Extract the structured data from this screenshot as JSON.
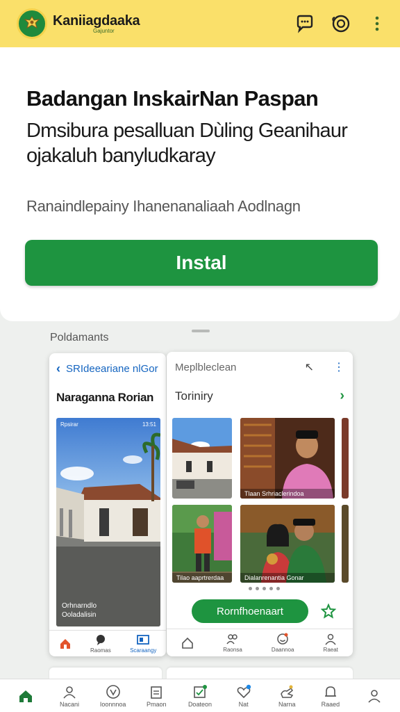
{
  "app": {
    "name": "Kaniiagdaaka",
    "tagline": "Gajuntor"
  },
  "header": {
    "actions": [
      "chat-icon",
      "smiley-icon",
      "more-vertical-icon"
    ]
  },
  "hero": {
    "title": "Badangan InskairNan Paspan",
    "description": "Dmsibura pesalluan Dùling Geanihaur ojakaluh banyludkaray",
    "note": "Ranaindlepainy Ihanenanaliaah Aodlnagn",
    "install_label": "Instal"
  },
  "screenshots": {
    "label": "Poldamants",
    "phone_a": {
      "back_label": "SRIdeeariane nlGor",
      "title": "Naraganna Rorian",
      "status_left": "Rpsirar",
      "status_right": "13:51",
      "photo_caption_1": "Orhnarndlo",
      "photo_caption_2": "Ooladalisin",
      "nav": [
        {
          "label": "",
          "icon": "home-icon"
        },
        {
          "label": "Raomas",
          "icon": "chat-icon"
        },
        {
          "label": "Scaraangy",
          "icon": "gallery-icon"
        }
      ]
    },
    "phone_b": {
      "header": "Meplbleclean",
      "subheader": "Toriniry",
      "thumb_captions": [
        "",
        "Tlaan Srhriaclerindoa",
        "Tilao aaprtrerdaa",
        "Dialanrenantia Gonar"
      ],
      "action_label": "Rornfhoenaart",
      "nav": [
        {
          "label": "",
          "icon": "home-icon"
        },
        {
          "label": "Raonsa",
          "icon": "people-icon"
        },
        {
          "label": "Daannoa",
          "icon": "smiley-icon"
        },
        {
          "label": "Raeat",
          "icon": "person-icon"
        }
      ]
    }
  },
  "bottom_nav": [
    {
      "label": "",
      "icon": "home-icon",
      "active": true
    },
    {
      "label": "Nacani",
      "icon": "settings-person-icon"
    },
    {
      "label": "Ioonnnoa",
      "icon": "shield-icon"
    },
    {
      "label": "Pmaon",
      "icon": "clipboard-icon"
    },
    {
      "label": "Doateon",
      "icon": "checklist-icon"
    },
    {
      "label": "Nat",
      "icon": "heart-badge-icon"
    },
    {
      "label": "Narna",
      "icon": "hand-icon"
    },
    {
      "label": "Raaed",
      "icon": "bell-icon"
    },
    {
      "label": "",
      "icon": "profile-icon"
    }
  ],
  "colors": {
    "accent": "#1e9440",
    "topbar": "#fae06a"
  }
}
